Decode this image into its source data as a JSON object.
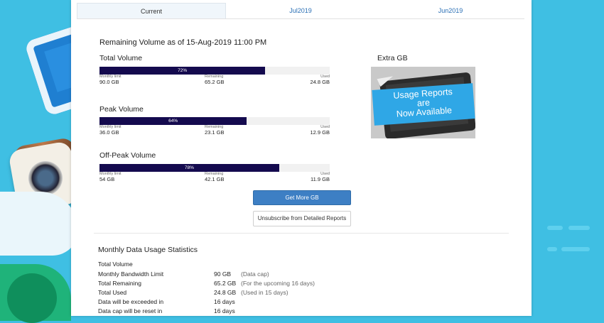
{
  "tabs": [
    "Current",
    "Jul2019",
    "Jun2019"
  ],
  "heading": "Remaining Volume as of 15-Aug-2019 11:00 PM",
  "volumes": [
    {
      "title": "Total Volume",
      "percent_label": "72%",
      "percent": 72,
      "limit_label": "Monthly limit",
      "limit": "90.0 GB",
      "remaining_label": "Remaining",
      "remaining": "65.2 GB",
      "used_label": "Used",
      "used": "24.8 GB"
    },
    {
      "title": "Peak Volume",
      "percent_label": "64%",
      "percent": 64,
      "limit_label": "Monthly limit",
      "limit": "36.0 GB",
      "remaining_label": "Remaining",
      "remaining": "23.1 GB",
      "used_label": "Used",
      "used": "12.9 GB"
    },
    {
      "title": "Off-Peak Volume",
      "percent_label": "78%",
      "percent": 78,
      "limit_label": "Monthly limit",
      "limit": "54 GB",
      "remaining_label": "Remaining",
      "remaining": "42.1 GB",
      "used_label": "Used",
      "used": "11.9 GB"
    }
  ],
  "extra": {
    "title": "Extra GB",
    "promo_lines": [
      "Usage Reports",
      "are",
      "Now Available"
    ]
  },
  "buttons": {
    "get_more": "Get More GB",
    "unsubscribe": "Unsubscribe from Detailed Reports"
  },
  "stats": {
    "title": "Monthly Data Usage Statistics",
    "subtitle": "Total Volume",
    "rows": [
      {
        "label": "Monthly Bandwidth Limit",
        "value": "90 GB",
        "note": "(Data cap)"
      },
      {
        "label": "Total Remaining",
        "value": "65.2 GB",
        "note": "(For the upcoming 16 days)"
      },
      {
        "label": "Total Used",
        "value": "24.8 GB",
        "note": "(Used in 15 days)"
      },
      {
        "label": "Data will be exceeded in",
        "value": "16 days",
        "note": ""
      },
      {
        "label": "Data cap will be reset in",
        "value": "16 days",
        "note": ""
      }
    ]
  },
  "colors": {
    "bar_fill": "#140a4e",
    "bar_track": "#f1f1f1",
    "primary_button": "#3d7fc4",
    "page_background": "#3fbfe3",
    "promo_banner": "#2fa7e6"
  }
}
